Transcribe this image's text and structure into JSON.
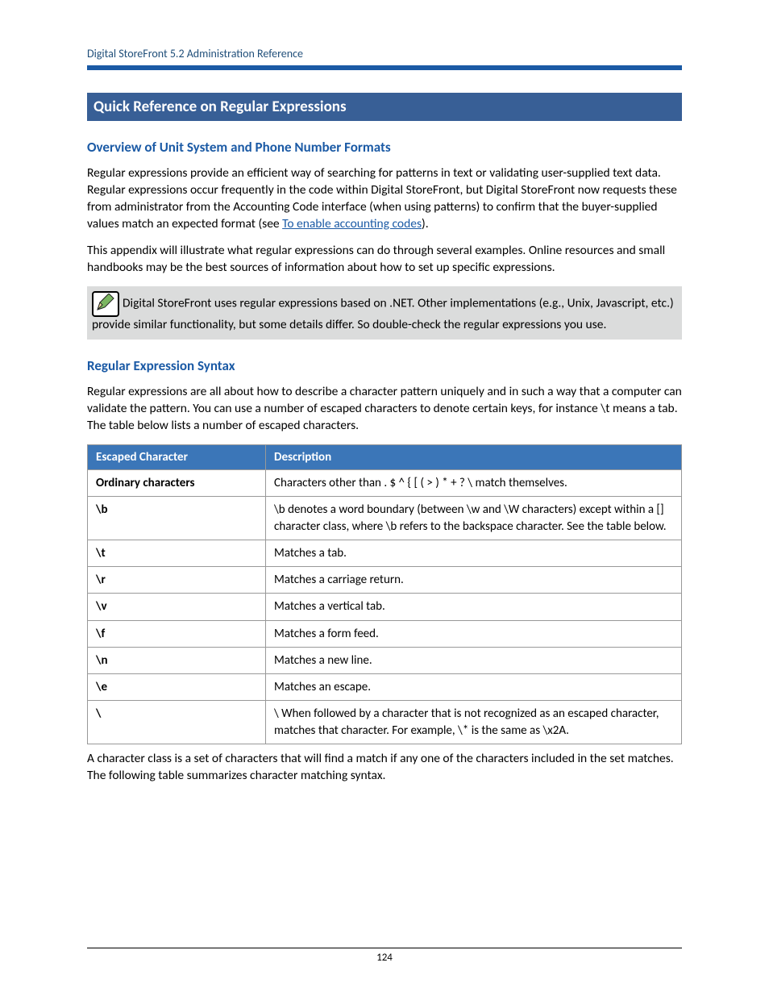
{
  "header": {
    "doc_title": "Digital StoreFront 5.2 Administration Reference"
  },
  "banner": "Quick Reference on Regular Expressions",
  "overview": {
    "heading": "Overview of Unit System and Phone Number Formats",
    "p1_a": "Regular expressions provide an efficient way of searching for patterns in text or validating user-supplied text data. Regular expressions occur frequently in the code within Digital StoreFront, but Digital StoreFront now requests these from administrator from the Accounting Code interface (when using patterns) to confirm that the buyer-supplied values match an expected format (see ",
    "p1_link": "To enable accounting codes",
    "p1_b": ").",
    "p2": "This appendix will illustrate what regular expressions can do through several examples. Online resources and small handbooks may be the best sources of information about how to set up specific expressions.",
    "note": "Digital StoreFront uses regular expressions based on .NET. Other implementations (e.g., Unix, Javascript, etc.) provide similar functionality, but some details differ. So double-check the regular expressions you use."
  },
  "syntax": {
    "heading": "Regular Expression Syntax",
    "intro": "Regular expressions are all about how to describe a character pattern uniquely and in such a way that a computer can validate the pattern. You can use a number of escaped characters to denote certain keys, for instance \\t means a tab. The table below lists a number of escaped characters.",
    "table": {
      "col1": "Escaped Character",
      "col2": "Description",
      "rows": [
        {
          "char": "Ordinary characters",
          "desc": "Characters other than . $ ^ { [ ( > ) * + ? \\ match themselves."
        },
        {
          "char": "\\b",
          "desc": "\\b denotes a word boundary (between \\w and \\W characters) except within a [] character class, where \\b refers to the backspace character. See the table below."
        },
        {
          "char": "\\t",
          "desc": "Matches a tab."
        },
        {
          "char": "\\r",
          "desc": "Matches a carriage return."
        },
        {
          "char": "\\v",
          "desc": "Matches a vertical tab."
        },
        {
          "char": "\\f",
          "desc": "Matches a form feed."
        },
        {
          "char": "\\n",
          "desc": "Matches a new line."
        },
        {
          "char": "\\e",
          "desc": "Matches an escape."
        },
        {
          "char": "\\",
          "desc": "\\  When followed by a character that is not recognized as an escaped character, matches that character. For example, \\* is the same as \\x2A."
        }
      ]
    },
    "outro": "A character class is a set of characters that will find a match if any one of the characters included in the set matches. The following table summarizes character matching syntax."
  },
  "footer": {
    "page_number": "124"
  }
}
